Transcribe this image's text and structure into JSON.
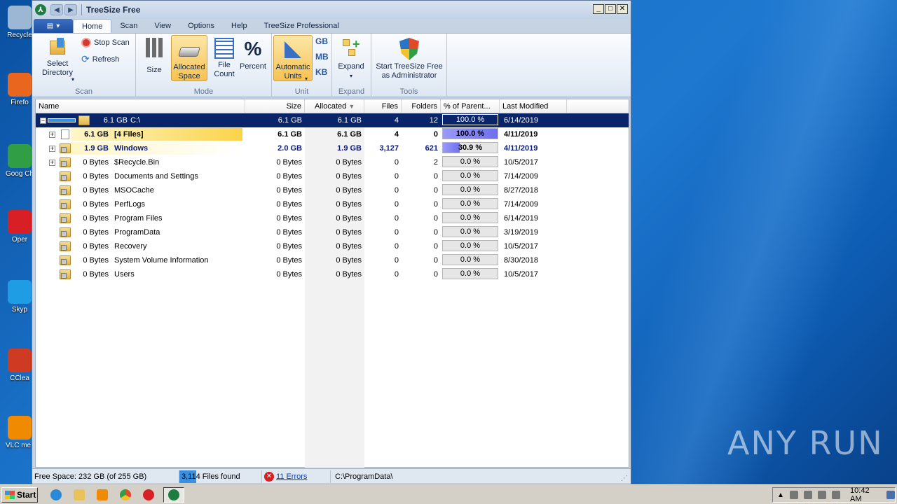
{
  "desktop": {
    "icons": [
      {
        "label": "Recycle",
        "color": "#9bb7d4"
      },
      {
        "label": "Firefo",
        "color": "#e8661e"
      },
      {
        "label": "Goog Chron",
        "color": "#2f9e44"
      },
      {
        "label": "Oper",
        "color": "#d81f26"
      },
      {
        "label": "Skyp",
        "color": "#1e9de4"
      },
      {
        "label": "CClea",
        "color": "#cf3a22"
      },
      {
        "label": "VLC me playe",
        "color": "#f08a00"
      }
    ],
    "watermark": "ANY RUN"
  },
  "window": {
    "title": "TreeSize Free",
    "controls": [
      "_",
      "□",
      "✕"
    ]
  },
  "tabs": [
    {
      "label": "Home",
      "active": true
    },
    {
      "label": "Scan"
    },
    {
      "label": "View"
    },
    {
      "label": "Options"
    },
    {
      "label": "Help"
    },
    {
      "label": "TreeSize Professional"
    }
  ],
  "ribbon": {
    "scan": {
      "label": "Scan",
      "select_directory": "Select\nDirectory",
      "stop_scan": "Stop Scan",
      "refresh": "Refresh"
    },
    "mode": {
      "label": "Mode",
      "size": "Size",
      "allocated_space": "Allocated Space",
      "file_count": "File Count",
      "percent": "Percent"
    },
    "unit": {
      "label": "Unit",
      "automatic_units": "Automatic Units",
      "gb": "GB",
      "mb": "MB",
      "kb": "KB"
    },
    "expand": {
      "label": "Expand",
      "expand": "Expand"
    },
    "tools": {
      "label": "Tools",
      "start_admin": "Start TreeSize Free as Administrator"
    }
  },
  "columns": {
    "name": "Name",
    "size": "Size",
    "allocated": "Allocated",
    "files": "Files",
    "folders": "Folders",
    "pct": "% of Parent...",
    "modified": "Last Modified"
  },
  "root": {
    "size_label": "6.1 GB",
    "name": "C:\\",
    "size": "6.1 GB",
    "allocated": "6.1 GB",
    "files": "4",
    "folders": "12",
    "pct": "100.0 %",
    "modified": "6/14/2019"
  },
  "rows": [
    {
      "size_label": "6.1 GB",
      "name": "[4 Files]",
      "size": "6.1 GB",
      "allocated": "6.1 GB",
      "files": "4",
      "folders": "0",
      "pct": "100.0 %",
      "modified": "4/11/2019"
    },
    {
      "size_label": "1.9 GB",
      "name": "Windows",
      "size": "2.0 GB",
      "allocated": "1.9 GB",
      "files": "3,127",
      "folders": "621",
      "pct": "30.9 %",
      "modified": "4/11/2019"
    },
    {
      "size_label": "0 Bytes",
      "name": "$Recycle.Bin",
      "size": "0 Bytes",
      "allocated": "0 Bytes",
      "files": "0",
      "folders": "2",
      "pct": "0.0 %",
      "modified": "10/5/2017"
    },
    {
      "size_label": "0 Bytes",
      "name": "Documents and Settings",
      "size": "0 Bytes",
      "allocated": "0 Bytes",
      "files": "0",
      "folders": "0",
      "pct": "0.0 %",
      "modified": "7/14/2009"
    },
    {
      "size_label": "0 Bytes",
      "name": "MSOCache",
      "size": "0 Bytes",
      "allocated": "0 Bytes",
      "files": "0",
      "folders": "0",
      "pct": "0.0 %",
      "modified": "8/27/2018"
    },
    {
      "size_label": "0 Bytes",
      "name": "PerfLogs",
      "size": "0 Bytes",
      "allocated": "0 Bytes",
      "files": "0",
      "folders": "0",
      "pct": "0.0 %",
      "modified": "7/14/2009"
    },
    {
      "size_label": "0 Bytes",
      "name": "Program Files",
      "size": "0 Bytes",
      "allocated": "0 Bytes",
      "files": "0",
      "folders": "0",
      "pct": "0.0 %",
      "modified": "6/14/2019"
    },
    {
      "size_label": "0 Bytes",
      "name": "ProgramData",
      "size": "0 Bytes",
      "allocated": "0 Bytes",
      "files": "0",
      "folders": "0",
      "pct": "0.0 %",
      "modified": "3/19/2019"
    },
    {
      "size_label": "0 Bytes",
      "name": "Recovery",
      "size": "0 Bytes",
      "allocated": "0 Bytes",
      "files": "0",
      "folders": "0",
      "pct": "0.0 %",
      "modified": "10/5/2017"
    },
    {
      "size_label": "0 Bytes",
      "name": "System Volume Information",
      "size": "0 Bytes",
      "allocated": "0 Bytes",
      "files": "0",
      "folders": "0",
      "pct": "0.0 %",
      "modified": "8/30/2018"
    },
    {
      "size_label": "0 Bytes",
      "name": "Users",
      "size": "0 Bytes",
      "allocated": "0 Bytes",
      "files": "0",
      "folders": "0",
      "pct": "0.0 %",
      "modified": "10/5/2017"
    }
  ],
  "status": {
    "free_space": "Free Space: 232 GB  (of 255 GB)",
    "files_found": "3,114 Files found",
    "errors": "11 Errors",
    "path": "C:\\ProgramData\\"
  },
  "taskbar": {
    "start": "Start",
    "clock": "10:42 AM"
  }
}
